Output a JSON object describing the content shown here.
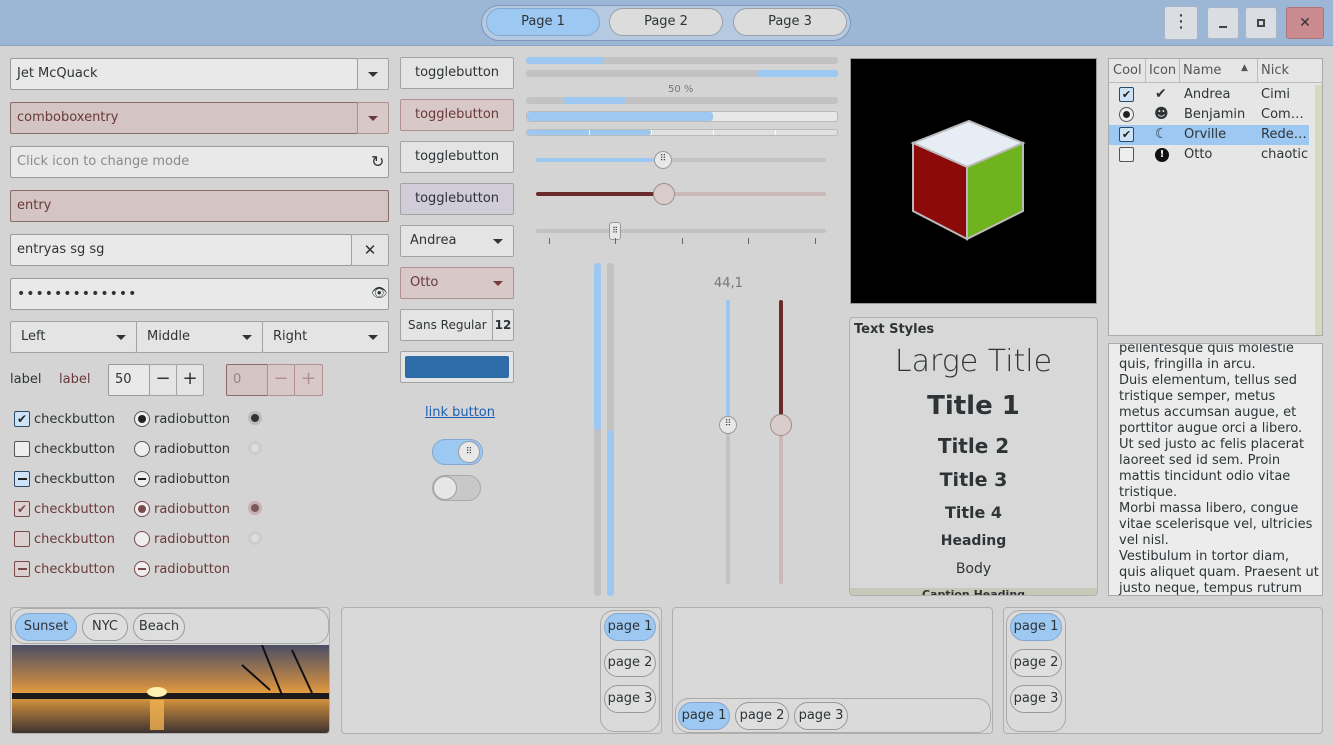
{
  "header": {
    "pages": [
      "Page 1",
      "Page 2",
      "Page 3"
    ],
    "active_page": 0,
    "menu_icon": "vertical-dots-icon",
    "minimize_icon": "minimize-icon",
    "maximize_icon": "maximize-icon",
    "close_icon": "close-icon"
  },
  "left": {
    "combo1_value": "Jet McQuack",
    "combo2_value": "comboboxentry",
    "entry_mode_placeholder": "Click icon to change mode",
    "entry_error_value": "entry",
    "entry_clear_value": "entryas sg sg",
    "password_value": "•••••••••••••",
    "align_combos": [
      "Left",
      "Middle",
      "Right"
    ],
    "label1": "label",
    "label2": "label",
    "spin1_value": "50",
    "spin2_value": "0",
    "check_label": "checkbutton",
    "radio_label": "radiobutton"
  },
  "mid": {
    "toggles": [
      "togglebutton",
      "togglebutton",
      "togglebutton",
      "togglebutton"
    ],
    "combo_andrea": "Andrea",
    "combo_otto": "Otto",
    "font_name": "Sans Regular",
    "font_size": "12",
    "color_value": "#2e6ca8",
    "link_label": "link button",
    "switch1_on": true,
    "switch2_on": false
  },
  "sliders": {
    "progress_label": "50 %",
    "progress_fractions": [
      0.25,
      0.26,
      0.2,
      0.6
    ],
    "hscale1_value": 0.44,
    "hscale2_value": 0.44,
    "hscale3_value": 0.27,
    "vscale_label": "44,1",
    "vscale_value": 0.44
  },
  "image": {
    "cube_icon": "gtk-cube-icon"
  },
  "tree": {
    "headers": [
      "Cool",
      "Icon",
      "Name",
      "Nick"
    ],
    "rows": [
      {
        "cool": "check",
        "icon": "check-circle-icon",
        "name": "Andrea",
        "nick": "Cimi"
      },
      {
        "cool": "radio",
        "icon": "face-icon",
        "name": "Benjamin",
        "nick": "Com…"
      },
      {
        "cool": "check",
        "icon": "moon-icon",
        "name": "Orville",
        "nick": "Rede…"
      },
      {
        "cool": "none",
        "icon": "warning-icon",
        "name": "Otto",
        "nick": "chaotic"
      }
    ]
  },
  "text_styles": {
    "title": "Text Styles",
    "large_title": "Large Title",
    "title1": "Title 1",
    "title2": "Title 2",
    "title3": "Title 3",
    "title4": "Title 4",
    "heading": "Heading",
    "body": "Body",
    "caption_heading": "Caption Heading"
  },
  "textview": {
    "lines": [
      "pellentesque quis molestie",
      "quis, fringilla in arcu.",
      "Duis elementum, tellus sed",
      "tristique semper, metus",
      "metus accumsan augue, et",
      "porttitor augue orci a libero.",
      "Ut sed justo ac felis placerat",
      "laoreet sed id sem. Proin",
      "mattis tincidunt odio vitae",
      "tristique.",
      "Morbi massa libero, congue",
      "vitae scelerisque vel, ultricies",
      "vel nisl.",
      "Vestibulum in tortor diam,",
      "quis aliquet quam. Praesent ut",
      "justo neque, tempus rutrum"
    ]
  },
  "bottom": {
    "photo_tabs": [
      "Sunset",
      "NYC",
      "Beach"
    ],
    "stack_pages": [
      "page 1",
      "page 2",
      "page 3"
    ]
  }
}
